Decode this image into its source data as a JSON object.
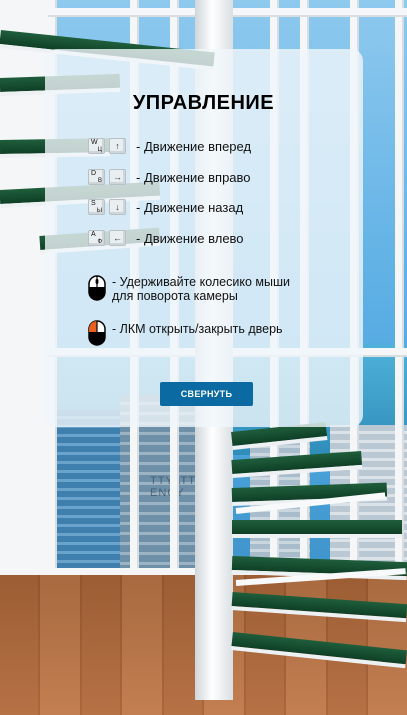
{
  "panel": {
    "title": "УПРАВЛЕНИЕ",
    "key_rows": [
      {
        "key_lat": "W",
        "key_cyr": "Ц",
        "arrow": "↑",
        "label": "- Движение вперед"
      },
      {
        "key_lat": "D",
        "key_cyr": "В",
        "arrow": "→",
        "label": "- Движение вправо"
      },
      {
        "key_lat": "S",
        "key_cyr": "Ы",
        "arrow": "↓",
        "label": "- Движение назад"
      },
      {
        "key_lat": "A",
        "key_cyr": "Ф",
        "arrow": "←",
        "label": "- Движение влево"
      }
    ],
    "mouse_wheel_label_line1": "- Удерживайте колесико мыши",
    "mouse_wheel_label_line2": "для поворота камеры",
    "mouse_lmb_label": "- ЛКМ открыть/закрыть дверь",
    "collapse_button": "СВЕРНУТЬ"
  },
  "scene": {
    "building_sign": "TTYATT",
    "building_sign_sub": "ENCY"
  },
  "colors": {
    "button_bg": "#0a6aa1",
    "tread": "#1f5e3c",
    "mouse_highlight": "#e8601e"
  }
}
